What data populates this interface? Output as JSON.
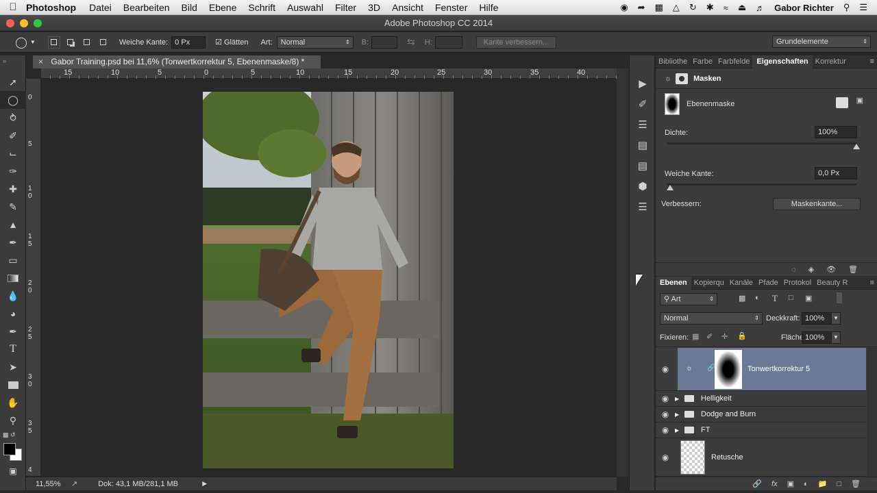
{
  "menubar": {
    "app": "Photoshop",
    "items": [
      "Datei",
      "Bearbeiten",
      "Bild",
      "Ebene",
      "Schrift",
      "Auswahl",
      "Filter",
      "3D",
      "Ansicht",
      "Fenster",
      "Hilfe"
    ],
    "user": "Gabor Richter"
  },
  "window": {
    "title": "Adobe Photoshop CC 2014"
  },
  "options": {
    "feather_label": "Weiche Kante:",
    "feather_value": "0 Px",
    "antialias_label": "Glätten",
    "style_label": "Art:",
    "style_value": "Normal",
    "width_label": "B:",
    "height_label": "H:",
    "refine_edge_label": "Kante verbessern...",
    "workspace": "Grundelemente"
  },
  "document": {
    "tab_title": "Gabor Training.psd bei 11,6% (Tonwertkorrektur 5, Ebenenmaske/8) *",
    "ruler_top": [
      "15",
      "10",
      "5",
      "0",
      "5",
      "10",
      "15",
      "20",
      "25",
      "30",
      "35",
      "40"
    ],
    "ruler_left": [
      "0",
      "5",
      "1\n0",
      "1\n5",
      "2\n0",
      "2\n5",
      "3\n0",
      "3\n5",
      "4"
    ]
  },
  "status": {
    "zoom": "11,55%",
    "doc_size": "Dok: 43,1 MB/281,1 MB"
  },
  "properties": {
    "tabs": [
      "Bibliothe",
      "Farbe",
      "Farbfelde",
      "Eigenschaften",
      "Korrektur"
    ],
    "active_tab": "Eigenschaften",
    "header": "Masken",
    "mask_label": "Ebenenmaske",
    "density_label": "Dichte:",
    "density_value": "100%",
    "density_fraction": 1.0,
    "feather_label": "Weiche Kante:",
    "feather_value": "0,0 Px",
    "feather_fraction": 0.0,
    "refine_label": "Verbessern:",
    "mask_edge_button": "Maskenkante..."
  },
  "layers": {
    "tabs": [
      "Ebenen",
      "Kopierqu",
      "Kanäle",
      "Pfade",
      "Protokol",
      "Beauty R"
    ],
    "active_tab": "Ebenen",
    "filter_value": "Art",
    "blend_mode": "Normal",
    "opacity_label": "Deckkraft:",
    "opacity_value": "100%",
    "lock_label": "Fixieren:",
    "fill_label": "Fläche:",
    "fill_value": "100%",
    "rows": [
      {
        "name": "Tonwertkorrektur 5",
        "type": "adjustment",
        "selected": true
      },
      {
        "name": "Helligkeit",
        "type": "group",
        "selected": false
      },
      {
        "name": "Dodge and Burn",
        "type": "group",
        "selected": false
      },
      {
        "name": "FT",
        "type": "group",
        "selected": false
      },
      {
        "name": "Retusche",
        "type": "pixel",
        "selected": false
      }
    ]
  },
  "colors": {
    "selected_layer": "#6a7a96",
    "panel_bg": "#3c3c3c",
    "canvas_bg": "#282828"
  }
}
